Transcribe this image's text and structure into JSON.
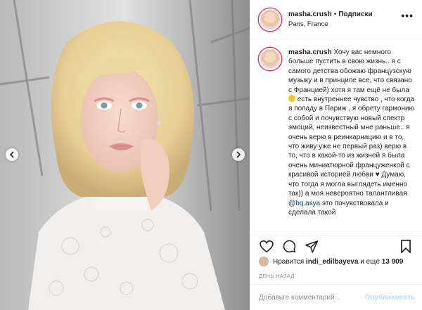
{
  "post": {
    "username": "masha.crush",
    "dot": "•",
    "follow_label": "Подписки",
    "location": "Paris, France",
    "more_label": "•••"
  },
  "caption": {
    "username": "masha.crush",
    "text_1": "Хочу вас немного больше пустить в свою жизнь.. я с самого детства обожаю французскую музыку и в принципе все, что связано с Францией) хотя я там ещё не была",
    "text_2": "есть внутреннее чувство , что когда я попаду в Париж , я обрету гармонию с собой и почувствую новый спектр эмоций, неизвестный мне раньше.. я очень верю в реинкарнацию и в то, что живу уже не первый раз) верю в то, что в какой-то из жизней я была очень миниатюрной француженкой с красивой историей любви ♥ Думаю, что тогда я могла выглядеть именно так)) а моя невероятно талантливая",
    "mention": "@bq.asya",
    "text_3": "это почувствовала и сделала такой"
  },
  "likes": {
    "prefix": "Нравится",
    "user": "indi_edilbayeva",
    "middle": "и ещё",
    "count": "13 909"
  },
  "date_label": "ДЕНЬ НАЗАД",
  "comment_box": {
    "placeholder": "Добавьте комментарий...",
    "publish_label": "Опубликовать"
  },
  "colors": {
    "accent_blue": "#0095f6",
    "publish_disabled": "#b2dffc",
    "text": "#262626",
    "muted": "#8e8e8e"
  },
  "icons": [
    "heart-icon",
    "comment-icon",
    "share-icon",
    "bookmark-icon",
    "chevron-left-icon",
    "chevron-right-icon",
    "more-icon"
  ]
}
